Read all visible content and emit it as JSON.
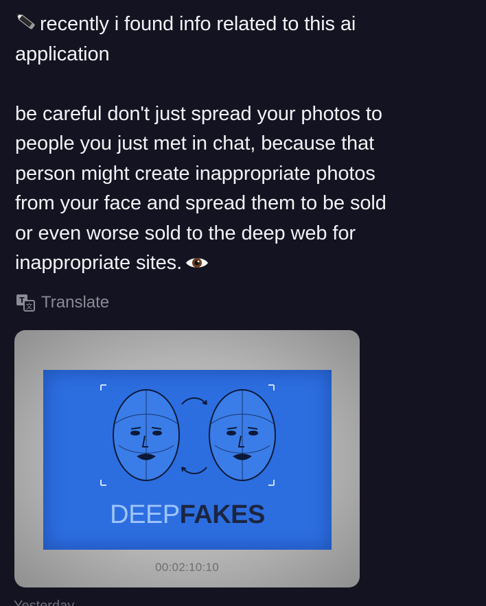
{
  "post": {
    "text_lines": [
      "recently i found info related to this ai",
      "application",
      "be careful don't just spread your photos to",
      "people you just met in chat, because that",
      "person might create inappropriate photos",
      "from your face and spread them to be sold",
      "or even worse sold to the deep web for",
      "inappropriate sites."
    ],
    "leading_icon": "pencil-icon",
    "trailing_icon": "eye-icon",
    "translate_label": "Translate",
    "translate_icon": "translate-icon"
  },
  "media": {
    "title_light": "DEEP",
    "title_bold": "FAKES",
    "timecode": "00:02:10:10"
  },
  "footer": {
    "timestamp_partial": "Yesterday"
  },
  "colors": {
    "background": "#141321",
    "text": "#f2f2f6",
    "muted": "#8b8a96",
    "media_blue": "#2c6ee0"
  }
}
